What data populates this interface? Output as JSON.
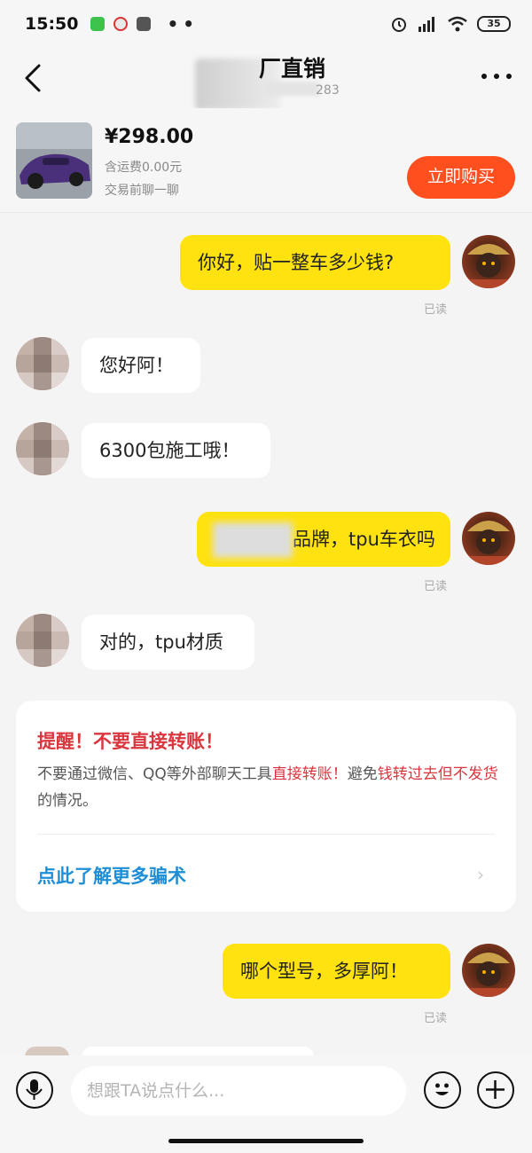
{
  "status_bar": {
    "time": "15:50",
    "battery": "35",
    "icons": [
      "wechat-icon",
      "app-icon",
      "tiktok-icon",
      "alarm-icon",
      "hd-signal-icon",
      "wifi-icon",
      "battery-icon"
    ]
  },
  "header": {
    "title_visible": "厂直销",
    "subtitle_visible": "283"
  },
  "product": {
    "price": "¥298.00",
    "shipping": "含运费0.00元",
    "hint": "交易前聊一聊",
    "buy_label": "立即购买"
  },
  "messages": [
    {
      "from": "me",
      "text": "你好，贴一整车多少钱?",
      "read": "已读"
    },
    {
      "from": "other",
      "text": "您好阿！"
    },
    {
      "from": "other",
      "text": "6300包施工哦！"
    },
    {
      "from": "me",
      "text": "品牌，tpu车衣吗",
      "read": "已读"
    },
    {
      "from": "other",
      "text": "对的，tpu材质"
    },
    {
      "from": "me",
      "text": "哪个型号，多厚阿！",
      "read": "已读"
    }
  ],
  "warning": {
    "title": "提醒！不要直接转账！",
    "body_part1": "不要通过微信、QQ等外部聊天工具",
    "body_red1": "直接转账！",
    "body_part2": "避免",
    "body_red2": "钱转过去但不发货",
    "body_part3": "的情况。",
    "link": "点此了解更多骗术"
  },
  "input": {
    "placeholder": "想跟TA说点什么..."
  },
  "colors": {
    "my_bubble": "#ffe210",
    "buy_button": "#ff4f1e",
    "warning_red": "#d9363e",
    "link_blue": "#1e8fd6"
  }
}
